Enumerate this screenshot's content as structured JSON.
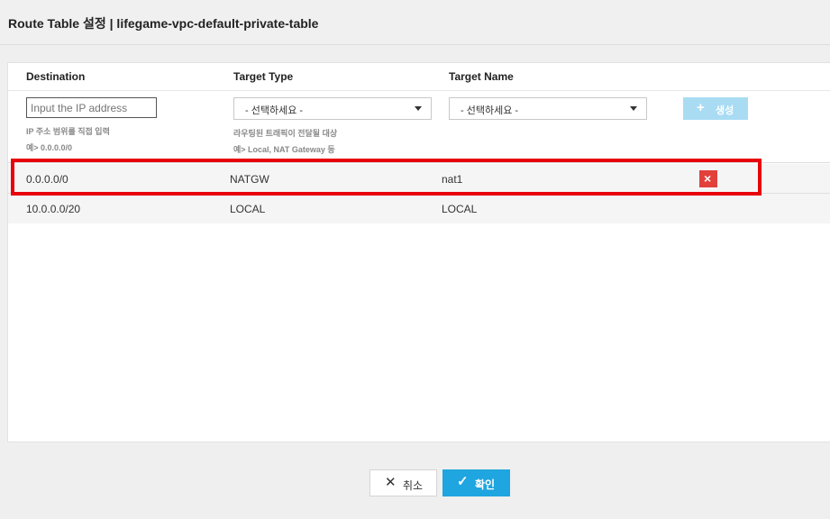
{
  "header": {
    "title": "Route Table 설정 | lifegame-vpc-default-private-table"
  },
  "table": {
    "columns": [
      "Destination",
      "Target Type",
      "Target Name"
    ]
  },
  "form": {
    "destination": {
      "placeholder": "Input the IP address",
      "value": "",
      "help1": "IP 주소 범위를 직접 입력",
      "help2": "예> 0.0.0.0/0"
    },
    "target_type": {
      "selected": "- 선택하세요 -",
      "help1": "라우팅된 트래픽이 전달될 대상",
      "help2": "예> Local, NAT Gateway 등"
    },
    "target_name": {
      "selected": "- 선택하세요 -"
    },
    "create_label": "생성",
    "create_icon": "plus-icon"
  },
  "routes": [
    {
      "destination": "0.0.0.0/0",
      "target_type": "NATGW",
      "target_name": "nat1",
      "deletable": true,
      "highlighted": true
    },
    {
      "destination": "10.0.0.0/20",
      "target_type": "LOCAL",
      "target_name": "LOCAL",
      "deletable": false,
      "highlighted": false
    }
  ],
  "footer": {
    "cancel_label": "취소",
    "confirm_label": "확인"
  },
  "colors": {
    "highlight": "#e8000b",
    "delete": "#e2403a",
    "confirm": "#1fa5df",
    "create_disabled": "#a9dcf3"
  }
}
